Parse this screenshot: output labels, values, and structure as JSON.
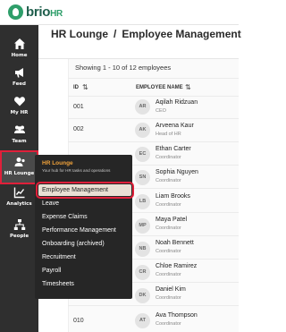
{
  "brand": {
    "name": "brio",
    "suffix": "HR",
    "color": "#2e9e6a"
  },
  "sidebar": {
    "items": [
      {
        "label": "Home",
        "icon": "home-icon"
      },
      {
        "label": "Feed",
        "icon": "megaphone-icon"
      },
      {
        "label": "My HR",
        "icon": "heart-icon"
      },
      {
        "label": "Team",
        "icon": "team-icon"
      },
      {
        "label": "HR Lounge",
        "icon": "user-group-icon"
      },
      {
        "label": "Analytics",
        "icon": "chart-icon"
      },
      {
        "label": "People",
        "icon": "org-chart-icon"
      }
    ]
  },
  "header": {
    "section": "HR Lounge",
    "separator": "/",
    "page": "Employee Management"
  },
  "table": {
    "count_text": "Showing 1 - 10 of 12 employees",
    "columns": [
      "ID",
      "EMPLOYEE NAME"
    ],
    "rows": [
      {
        "id": "001",
        "initials": "AR",
        "name": "Aqilah Ridzuan",
        "role": "CEO"
      },
      {
        "id": "002",
        "initials": "AK",
        "name": "Arveena Kaur",
        "role": "Head of HR"
      },
      {
        "id": "",
        "initials": "EC",
        "name": "Ethan Carter",
        "role": "Coordinator"
      },
      {
        "id": "",
        "initials": "SN",
        "name": "Sophia Nguyen",
        "role": "Coordinator"
      },
      {
        "id": "",
        "initials": "LB",
        "name": "Liam Brooks",
        "role": "Coordinator"
      },
      {
        "id": "",
        "initials": "MP",
        "name": "Maya Patel",
        "role": "Coordinator"
      },
      {
        "id": "",
        "initials": "NB",
        "name": "Noah Bennett",
        "role": "Coordinator"
      },
      {
        "id": "",
        "initials": "CR",
        "name": "Chloe Ramirez",
        "role": "Coordinator"
      },
      {
        "id": "",
        "initials": "DK",
        "name": "Daniel Kim",
        "role": "Coordinator"
      },
      {
        "id": "010",
        "initials": "AT",
        "name": "Ava Thompson",
        "role": "Coordinator"
      }
    ]
  },
  "flyout": {
    "title": "HR Lounge",
    "subtitle": "Your hub for HR tasks and operations",
    "items": [
      "Employee Management",
      "Leave",
      "Expense Claims",
      "Performance Management",
      "Onboarding (archived)",
      "Recruitment",
      "Payroll",
      "Timesheets"
    ],
    "selected": "Employee Management"
  },
  "colors": {
    "sidebar": "#2f2f2f",
    "flyout": "#262626",
    "accent": "#f0a23a",
    "highlight": "#e0203a",
    "selected_bg": "#e9e0d4"
  }
}
